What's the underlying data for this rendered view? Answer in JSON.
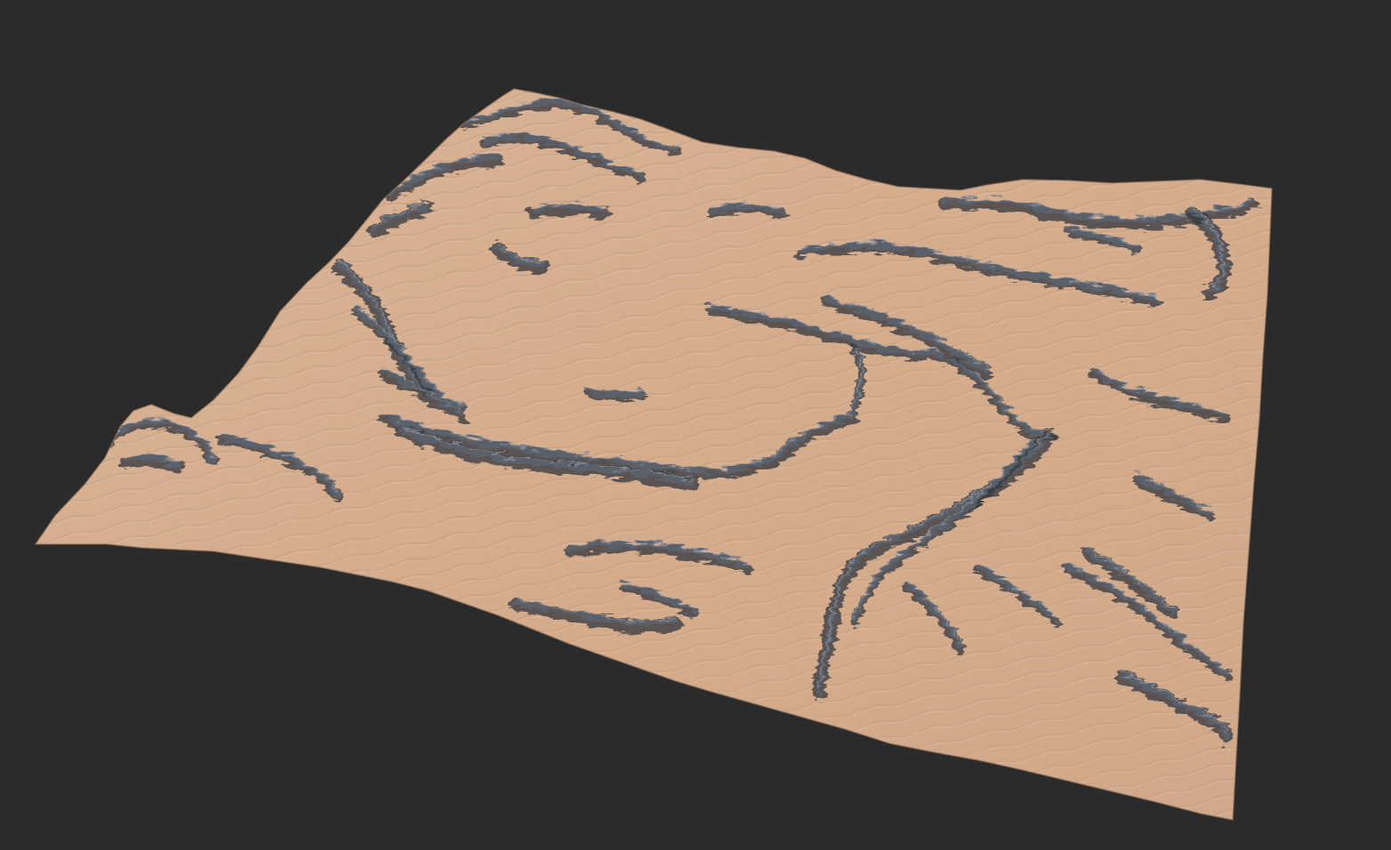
{
  "viewport": {
    "background_color": "#2b2b2b"
  },
  "terrain": {
    "description_type": "heightfield-render",
    "sand_color": "#d6ad8c",
    "sand_highlight_color": "#e2bd9e",
    "sand_shadow_color": "#b98f73",
    "rock_color": "#5d6470",
    "rock_dark_color": "#30353f",
    "rock_light_color": "#8e96a3"
  }
}
